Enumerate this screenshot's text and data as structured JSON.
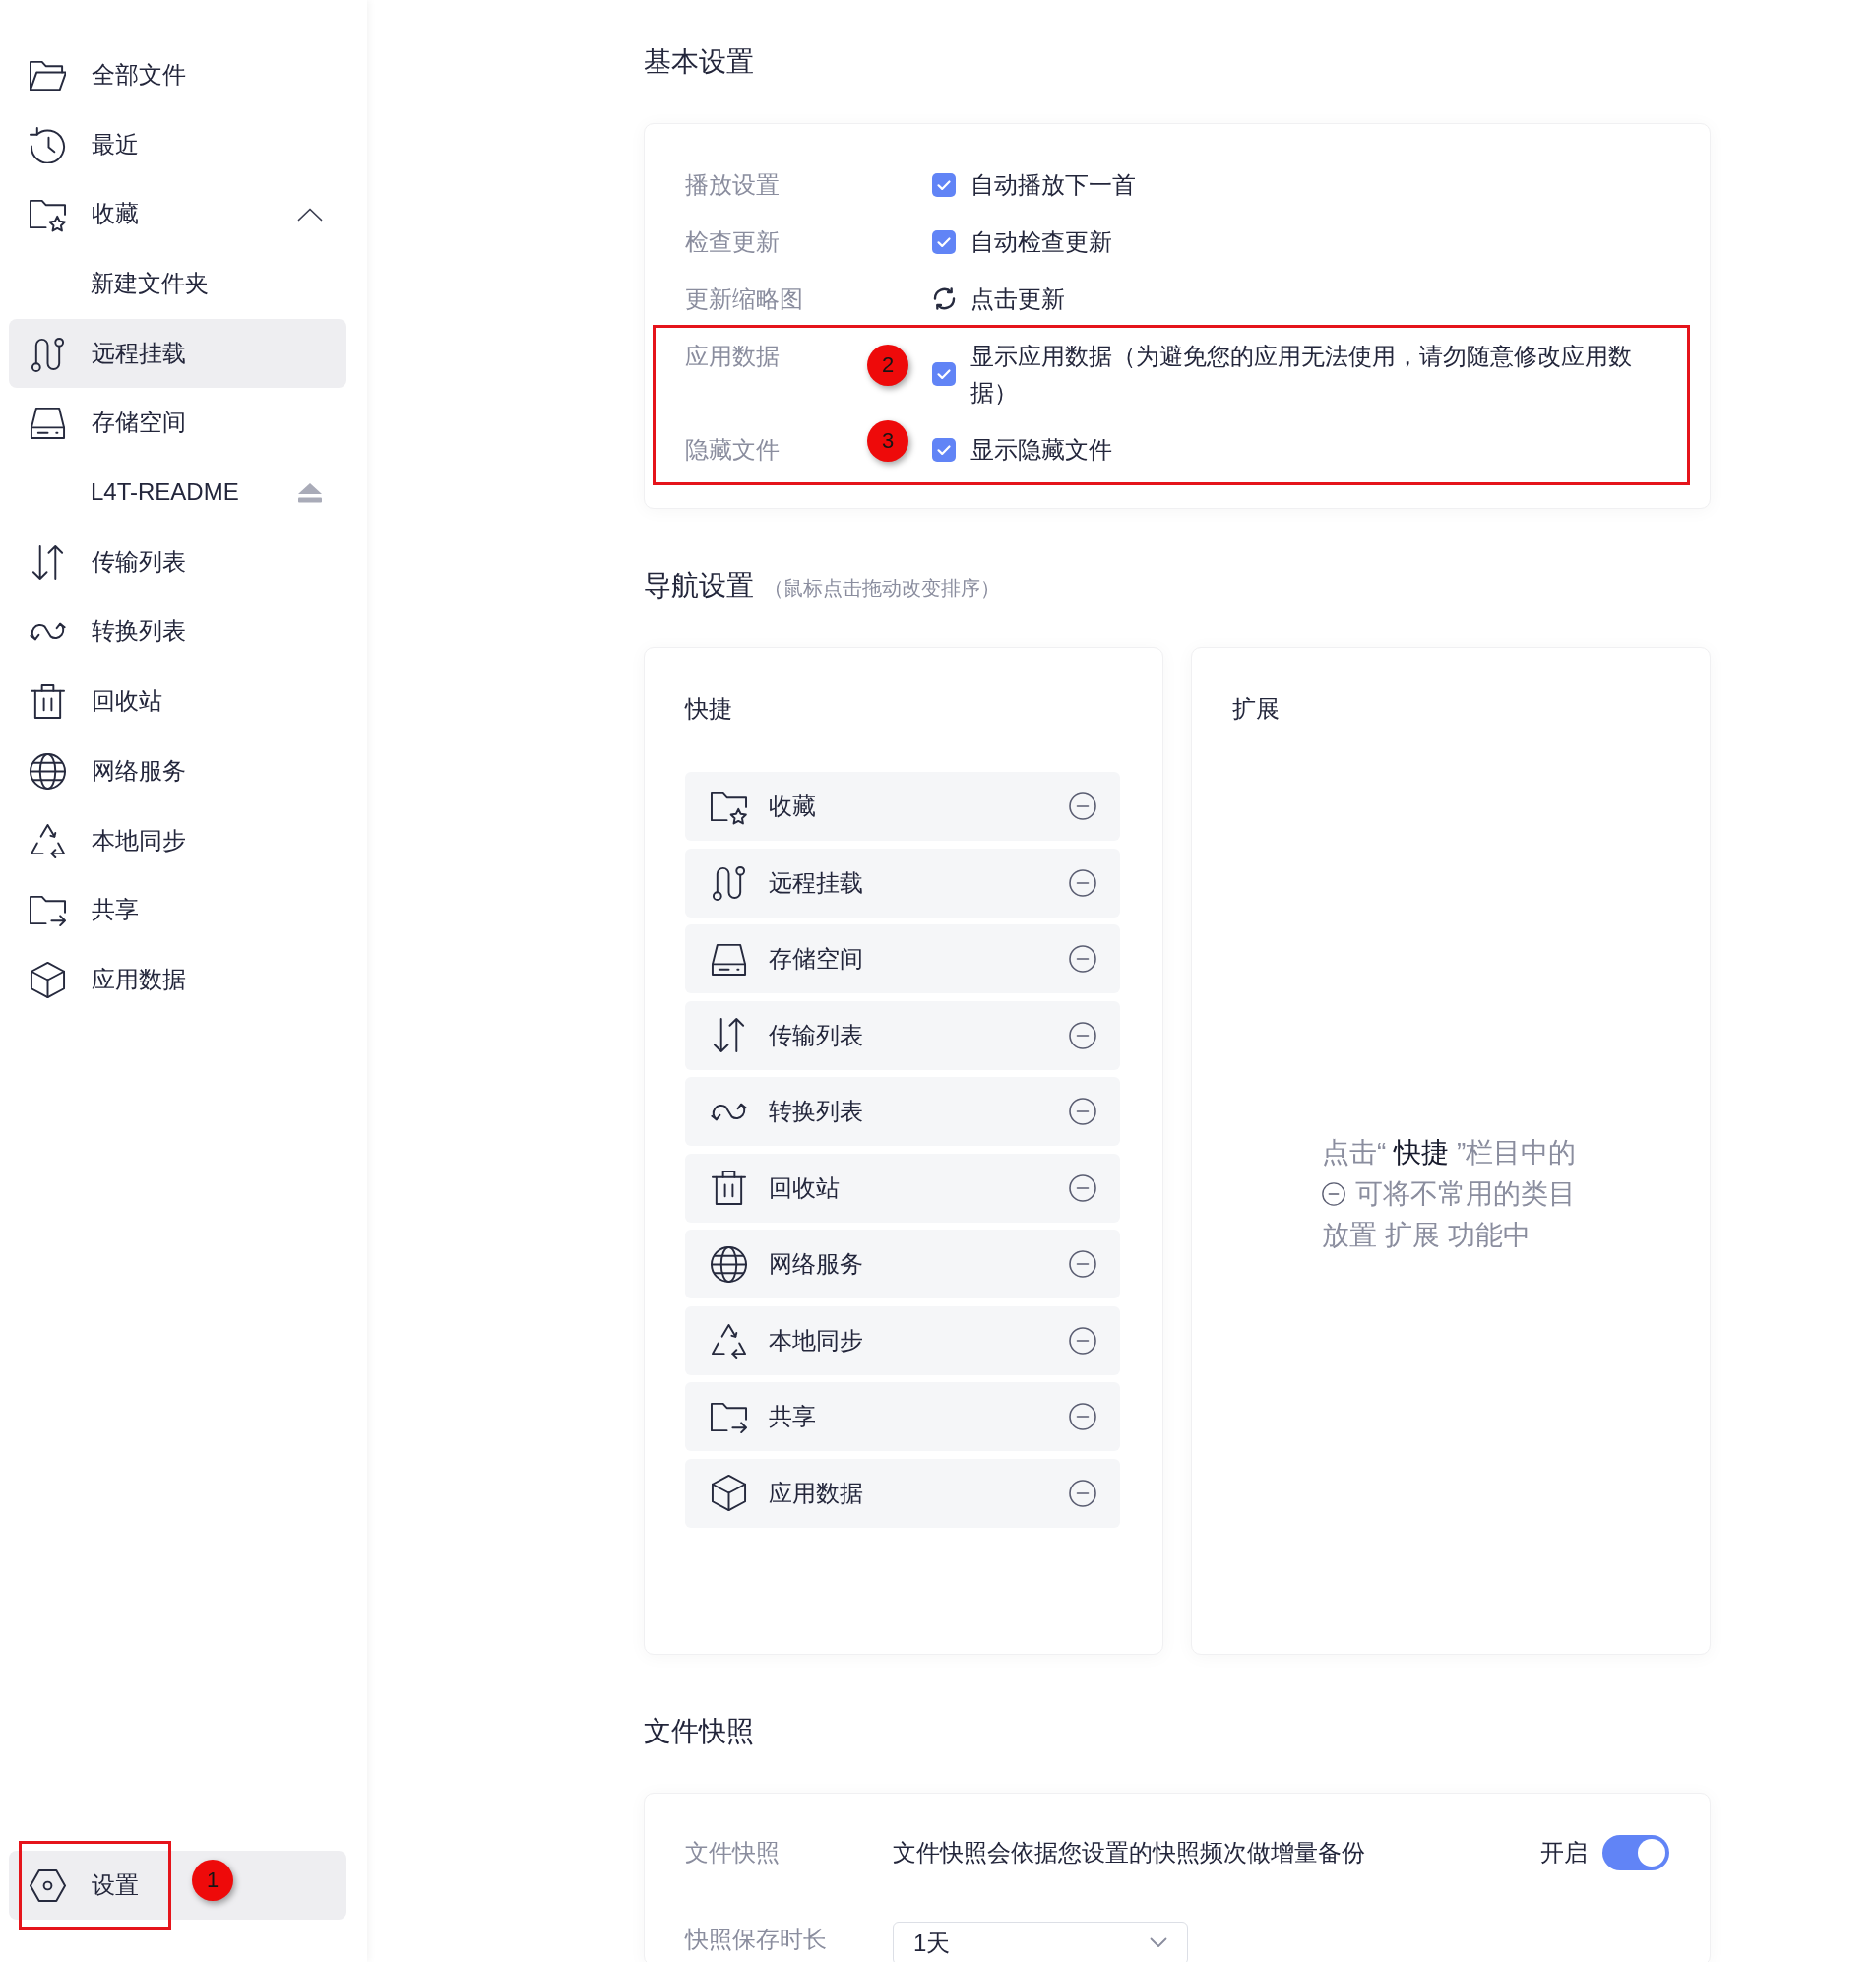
{
  "sidebar": {
    "items": [
      {
        "kind": "files",
        "label": "全部文件",
        "selected": false
      },
      {
        "kind": "recent",
        "label": "最近",
        "selected": false
      },
      {
        "kind": "favorites",
        "label": "收藏",
        "selected": false,
        "expanded": true,
        "children": [
          {
            "kind": "folder",
            "label": "新建文件夹",
            "selected": false
          }
        ]
      },
      {
        "kind": "remote",
        "label": "远程挂载",
        "selected": true
      },
      {
        "kind": "storage",
        "label": "存储空间",
        "selected": false,
        "children": [
          {
            "kind": "volume",
            "label": "L4T-README",
            "selected": false
          }
        ]
      },
      {
        "kind": "transfer",
        "label": "传输列表",
        "selected": false
      },
      {
        "kind": "convert",
        "label": "转换列表",
        "selected": false
      },
      {
        "kind": "trash",
        "label": "回收站",
        "selected": false
      },
      {
        "kind": "network",
        "label": "网络服务",
        "selected": false
      },
      {
        "kind": "sync",
        "label": "本地同步",
        "selected": false
      },
      {
        "kind": "share",
        "label": "共享",
        "selected": false
      },
      {
        "kind": "appdata",
        "label": "应用数据",
        "selected": false
      }
    ],
    "footer": {
      "kind": "settings",
      "label": "设置",
      "selected": true,
      "highlighted": true,
      "callout": "1"
    }
  },
  "basic_settings": {
    "title": "基本设置",
    "groups": [
      {
        "highlighted": false,
        "rows": [
          {
            "label": "播放设置",
            "kind": "checkbox",
            "checked": true,
            "text": "自动播放下一首"
          },
          {
            "label": "检查更新",
            "kind": "checkbox",
            "checked": true,
            "text": "自动检查更新"
          },
          {
            "label": "更新缩略图",
            "kind": "action",
            "text": "点击更新"
          }
        ]
      },
      {
        "highlighted": true,
        "rows": [
          {
            "label": "应用数据",
            "kind": "checkbox",
            "checked": true,
            "text": "显示应用数据（为避免您的应用无法使用，请勿随意修改应用数据）",
            "callout": "2"
          },
          {
            "label": "隐藏文件",
            "kind": "checkbox",
            "checked": true,
            "text": "显示隐藏文件",
            "callout": "3"
          }
        ]
      }
    ]
  },
  "navigation_settings": {
    "title": "导航设置",
    "hint": "（鼠标点击拖动改变排序）",
    "shortcuts": {
      "title": "快捷",
      "items": [
        {
          "kind": "favorites",
          "label": "收藏"
        },
        {
          "kind": "remote",
          "label": "远程挂载"
        },
        {
          "kind": "storage",
          "label": "存储空间"
        },
        {
          "kind": "transfer",
          "label": "传输列表"
        },
        {
          "kind": "convert",
          "label": "转换列表"
        },
        {
          "kind": "trash",
          "label": "回收站"
        },
        {
          "kind": "network",
          "label": "网络服务"
        },
        {
          "kind": "sync",
          "label": "本地同步"
        },
        {
          "kind": "share",
          "label": "共享"
        },
        {
          "kind": "appdata",
          "label": "应用数据"
        }
      ]
    },
    "extensions": {
      "title": "扩展",
      "empty_hint": [
        {
          "text": "点击“ **快捷** ”栏目中的",
          "remove_icon": false
        },
        {
          "text": "可将不常用的类目",
          "remove_icon": true
        },
        {
          "text": "放置 扩展 功能中",
          "remove_icon": false
        }
      ]
    }
  },
  "file_snapshot": {
    "title": "文件快照",
    "rows": [
      {
        "kind": "toggle",
        "label": "文件快照",
        "description": "文件快照会依据您设置的快照频次做增量备份",
        "state_label": "开启",
        "on": true
      },
      {
        "kind": "select",
        "label": "快照保存时长",
        "value": "1天"
      }
    ]
  }
}
